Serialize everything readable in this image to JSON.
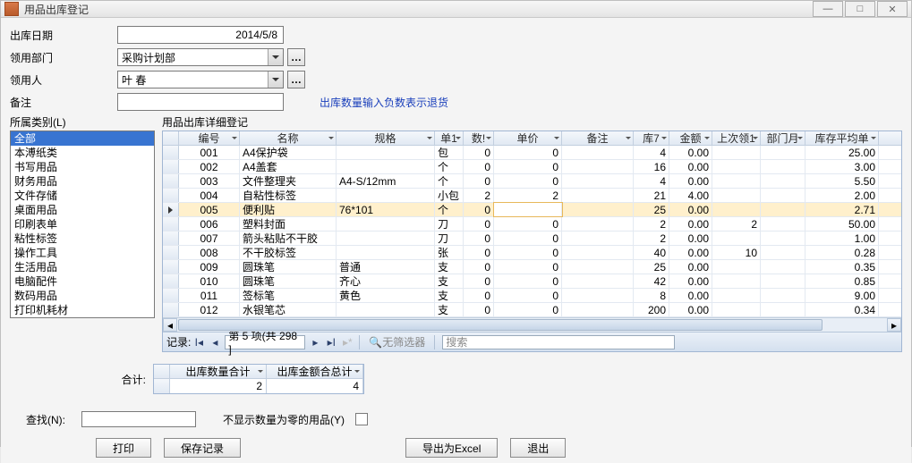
{
  "window": {
    "title": "用品出库登记"
  },
  "form": {
    "date_label": "出库日期",
    "date_value": "2014/5/8",
    "dept_label": "领用部门",
    "dept_value": "采购计划部",
    "person_label": "领用人",
    "person_value": "叶 春",
    "note_label": "备注",
    "note_value": "",
    "hint": "出库数量输入负数表示退货"
  },
  "category": {
    "label": "所属类别(L)",
    "items": [
      "全部",
      "本溥纸类",
      "书写用品",
      "财务用品",
      "文件存储",
      "桌面用品",
      "印刷表单",
      "粘性标签",
      "操作工具",
      "生活用品",
      "电脑配件",
      "数码用品",
      "打印机耗材"
    ],
    "selected": 0
  },
  "grid": {
    "label": "用品出库详细登记",
    "columns": [
      "编号",
      "名称",
      "规格",
      "单1",
      "数!",
      "单价",
      "备注",
      "库7",
      "金额",
      "上次领1",
      "部门月",
      "库存平均单"
    ],
    "rows": [
      {
        "id": "001",
        "name": "A4保护袋",
        "spec": "",
        "unit": "包",
        "qty": "0",
        "price": "0",
        "note": "",
        "stock": "4",
        "amt": "0.00",
        "last": "",
        "dept": "",
        "avg": "25.00"
      },
      {
        "id": "002",
        "name": "A4盖套",
        "spec": "",
        "unit": "个",
        "qty": "0",
        "price": "0",
        "note": "",
        "stock": "16",
        "amt": "0.00",
        "last": "",
        "dept": "",
        "avg": "3.00"
      },
      {
        "id": "003",
        "name": "文件整理夹",
        "spec": "A4-S/12mm",
        "unit": "个",
        "qty": "0",
        "price": "0",
        "note": "",
        "stock": "4",
        "amt": "0.00",
        "last": "",
        "dept": "",
        "avg": "5.50"
      },
      {
        "id": "004",
        "name": "自粘性标签",
        "spec": "",
        "unit": "小包",
        "qty": "2",
        "price": "2",
        "note": "",
        "stock": "21",
        "amt": "4.00",
        "last": "",
        "dept": "",
        "avg": "2.00"
      },
      {
        "id": "005",
        "name": "便利贴",
        "spec": "76*101",
        "unit": "个",
        "qty": "0",
        "price": "",
        "note": "",
        "stock": "25",
        "amt": "0.00",
        "last": "",
        "dept": "",
        "avg": "2.71",
        "sel": true
      },
      {
        "id": "006",
        "name": "塑料封面",
        "spec": "",
        "unit": "刀",
        "qty": "0",
        "price": "0",
        "note": "",
        "stock": "2",
        "amt": "0.00",
        "last": "2",
        "dept": "",
        "avg": "50.00"
      },
      {
        "id": "007",
        "name": "箭头粘贴不干胶",
        "spec": "",
        "unit": "刀",
        "qty": "0",
        "price": "0",
        "note": "",
        "stock": "2",
        "amt": "0.00",
        "last": "",
        "dept": "",
        "avg": "1.00"
      },
      {
        "id": "008",
        "name": "不干胶标签",
        "spec": "",
        "unit": "张",
        "qty": "0",
        "price": "0",
        "note": "",
        "stock": "40",
        "amt": "0.00",
        "last": "10",
        "dept": "",
        "avg": "0.28"
      },
      {
        "id": "009",
        "name": "圆珠笔",
        "spec": "普通",
        "unit": "支",
        "qty": "0",
        "price": "0",
        "note": "",
        "stock": "25",
        "amt": "0.00",
        "last": "",
        "dept": "",
        "avg": "0.35"
      },
      {
        "id": "010",
        "name": "圆珠笔",
        "spec": "齐心",
        "unit": "支",
        "qty": "0",
        "price": "0",
        "note": "",
        "stock": "42",
        "amt": "0.00",
        "last": "",
        "dept": "",
        "avg": "0.85"
      },
      {
        "id": "011",
        "name": "签标笔",
        "spec": "黄色",
        "unit": "支",
        "qty": "0",
        "price": "0",
        "note": "",
        "stock": "8",
        "amt": "0.00",
        "last": "",
        "dept": "",
        "avg": "9.00"
      },
      {
        "id": "012",
        "name": "水银笔芯",
        "spec": "",
        "unit": "支",
        "qty": "0",
        "price": "0",
        "note": "",
        "stock": "200",
        "amt": "0.00",
        "last": "",
        "dept": "",
        "avg": "0.34"
      }
    ],
    "nav": {
      "rec_label": "记录:",
      "position": "第 5 项(共 298 ]",
      "filter": "无筛选器",
      "search": "搜索"
    }
  },
  "totals": {
    "label": "合计:",
    "col1": "出库数量合计",
    "col2": "出库金额合总计",
    "v1": "2",
    "v2": "4"
  },
  "search": {
    "label": "查找(N):",
    "hide_zero_label": "不显示数量为零的用品(Y)"
  },
  "buttons": {
    "print": "打印",
    "save": "保存记录",
    "export": "导出为Excel",
    "exit": "退出"
  }
}
